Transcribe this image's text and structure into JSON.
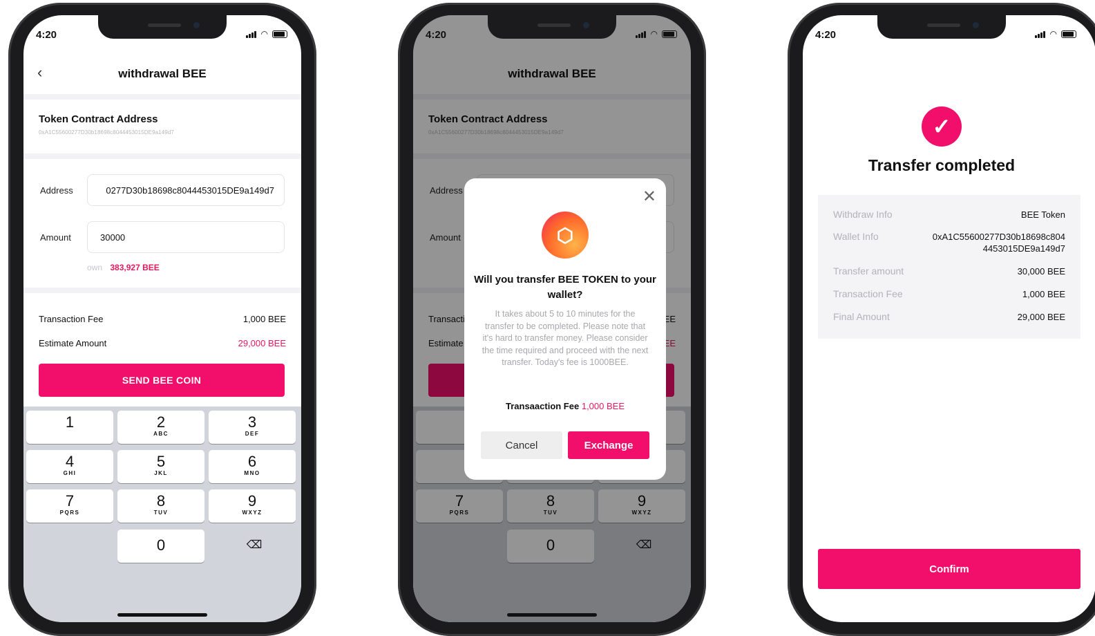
{
  "status": {
    "time": "4:20"
  },
  "screen1": {
    "title": "withdrawal BEE",
    "contract_label": "Token Contract Address",
    "contract_value": "0xA1C55600277D30b18698c8044453015DE9a149d7",
    "address_label": "Address",
    "address_value": "0277D30b18698c8044453015DE9a149d7",
    "amount_label": "Amount",
    "amount_value": "30000",
    "own_label": "own",
    "own_value": "383,927 BEE",
    "fee_label": "Transaction Fee",
    "fee_value": "1,000 BEE",
    "estimate_label": "Estimate Amount",
    "estimate_value": "29,000 BEE",
    "send_button": "SEND BEE COIN"
  },
  "keypad": {
    "keys": [
      {
        "n": "1",
        "l": ""
      },
      {
        "n": "2",
        "l": "ABC"
      },
      {
        "n": "3",
        "l": "DEF"
      },
      {
        "n": "4",
        "l": "GHI"
      },
      {
        "n": "5",
        "l": "JKL"
      },
      {
        "n": "6",
        "l": "MNO"
      },
      {
        "n": "7",
        "l": "PQRS"
      },
      {
        "n": "8",
        "l": "TUV"
      },
      {
        "n": "9",
        "l": "WXYZ"
      },
      {
        "n": "0",
        "l": ""
      }
    ],
    "delete_icon": "backspace-icon"
  },
  "screen2": {
    "title": "withdrawal BEE",
    "contract_label": "Token Contract Address",
    "contract_value": "0xA1C55600277D30b18698c8044453015DE9a149d7",
    "modal": {
      "question": "Will you transfer BEE TOKEN to your wallet?",
      "description": "It takes about 5 to 10 minutes for the transfer to be completed. Please note that it's hard to transfer money. Please consider the time required and proceed with the next transfer. Today's fee is 1000BEE.",
      "fee_label": "Transaaction Fee",
      "fee_value": "1,000 BEE",
      "cancel": "Cancel",
      "exchange": "Exchange"
    }
  },
  "screen3": {
    "title": "Transfer completed",
    "rows": [
      {
        "k": "Withdraw Info",
        "v": "BEE Token"
      },
      {
        "k": "Wallet Info",
        "v": "0xA1C55600277D30b18698c804\n4453015DE9a149d7"
      },
      {
        "k": "Transfer amount",
        "v": "30,000 BEE"
      },
      {
        "k": "Transaction Fee",
        "v": "1,000 BEE"
      },
      {
        "k": "Final Amount",
        "v": "29,000 BEE"
      }
    ],
    "confirm": "Confirm"
  },
  "colors": {
    "accent": "#f20f6b",
    "accent_text": "#e8175d"
  }
}
